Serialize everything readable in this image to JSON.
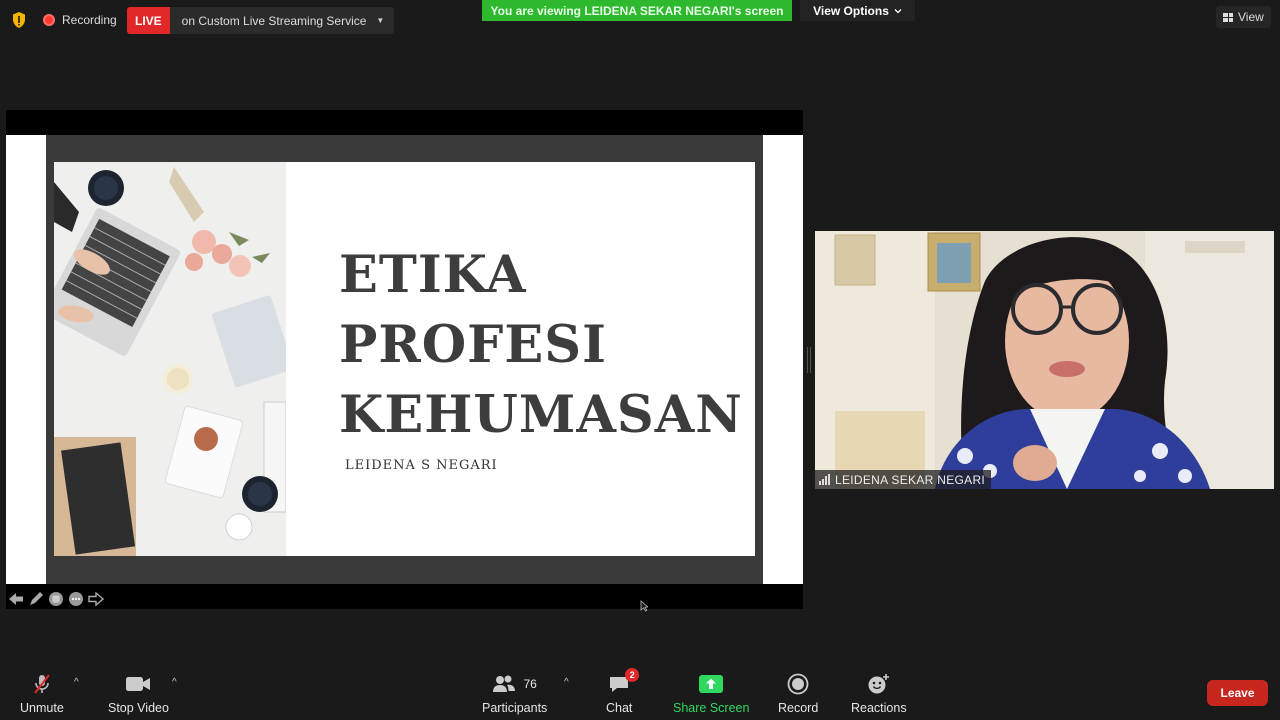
{
  "top_bar": {
    "recording_label": "Recording",
    "live_badge": "LIVE",
    "live_service": "on Custom Live Streaming Service",
    "viewing_banner": "You are viewing LEIDENA SEKAR NEGARI's screen",
    "view_options": "View Options",
    "view_button": "View"
  },
  "slide": {
    "title_lines": [
      "ETIKA",
      "PROFESI",
      "KEHUMASAN"
    ],
    "author": "LEIDENA S NEGARI"
  },
  "video": {
    "participant_name": "LEIDENA SEKAR NEGARI"
  },
  "toolbar": {
    "unmute": "Unmute",
    "stop_video": "Stop Video",
    "participants": "Participants",
    "participants_count": "76",
    "chat": "Chat",
    "chat_badge": "2",
    "share_screen": "Share Screen",
    "record": "Record",
    "reactions": "Reactions",
    "leave": "Leave"
  },
  "colors": {
    "background": "#1a1a1a",
    "live_red": "#e02828",
    "banner_green": "#2eb82e",
    "share_green": "#2fd85e",
    "leave_red": "#c8271f"
  },
  "icons": [
    "shield-icon",
    "record-dot-icon",
    "dropdown-caret-icon",
    "grid-view-icon",
    "muted-mic-icon",
    "video-camera-icon",
    "participants-icon",
    "chat-bubble-icon",
    "share-screen-arrow-icon",
    "record-icon",
    "reaction-smiley-icon"
  ]
}
